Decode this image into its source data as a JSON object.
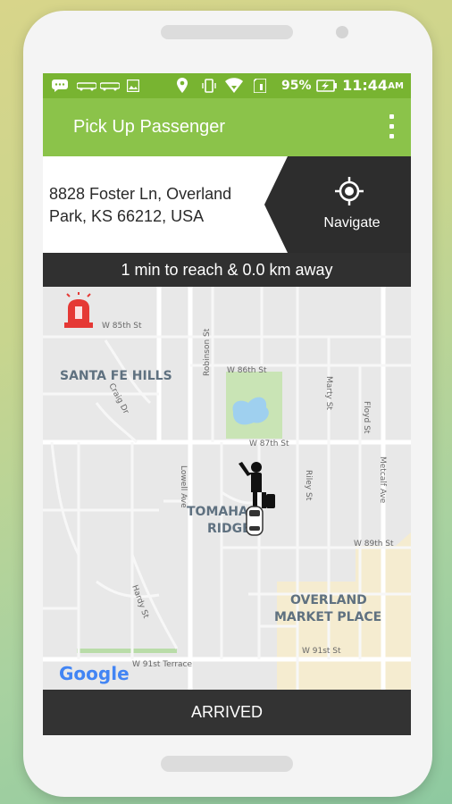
{
  "statusbar": {
    "battery": "95%",
    "time": "11:44",
    "ampm": "AM"
  },
  "toolbar": {
    "title": "Pick Up Passenger"
  },
  "address": {
    "line1": "8828 Foster Ln, Overland",
    "line2": "Park, KS 66212, USA"
  },
  "navigate": {
    "label": "Navigate"
  },
  "eta": {
    "text": "1 min to reach & 0.0 km away"
  },
  "map": {
    "areas": {
      "santa_fe_hills": "SANTA FE HILLS",
      "tomahawk_line1": "TOMAHA",
      "tomahawk_line2": "RIDGE",
      "overland_line1": "OVERLAND",
      "overland_line2": "MARKET PLACE"
    },
    "streets": {
      "w85": "W 85th St",
      "w86": "W 86th St",
      "w87": "W 87th St",
      "w89": "W 89th St",
      "w91": "W 91st St",
      "w91_terrace": "W 91st Terrace",
      "robinson": "Robinson St",
      "craig": "Craig Dr",
      "lowell": "Lowell Ave",
      "riley": "Riley St",
      "marty": "Marty St",
      "floyd": "Floyd St",
      "metcalf": "Metcalf Ave",
      "hardy": "Hardy St"
    },
    "logo": "Google"
  },
  "actions": {
    "arrived": "ARRIVED"
  }
}
